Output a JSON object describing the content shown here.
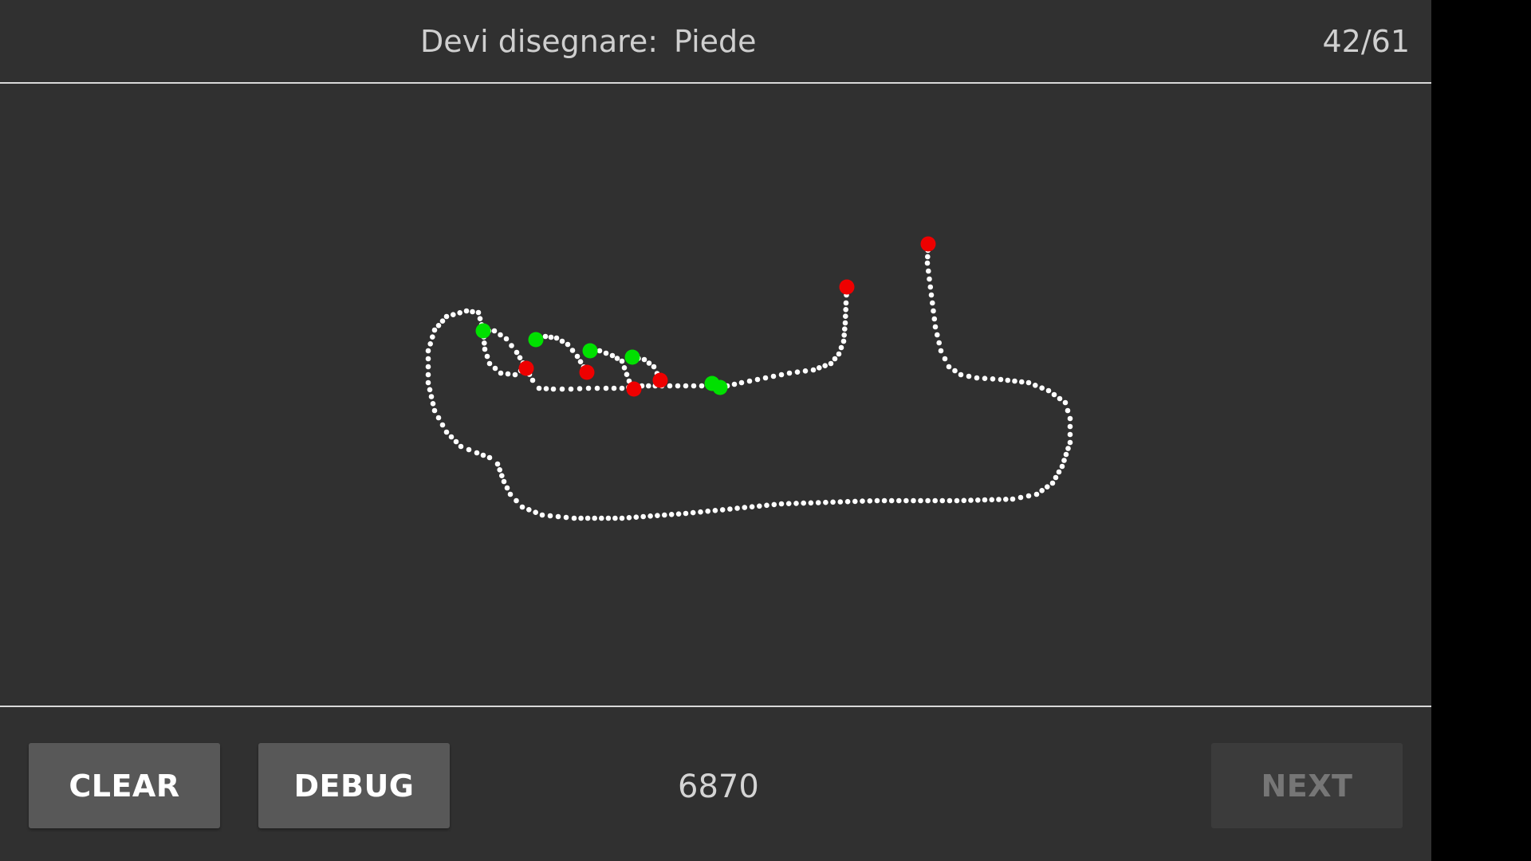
{
  "header": {
    "prompt_label": "Devi disegnare:",
    "prompt_word": "Piede",
    "progress": "42/61"
  },
  "canvas": {
    "background_color": "#303030",
    "stroke_color": "#ffffff",
    "start_marker_color": "#00e000",
    "end_marker_color": "#ee0000"
  },
  "footer": {
    "clear_label": "CLEAR",
    "debug_label": "DEBUG",
    "score": "6870",
    "next_label": "NEXT"
  }
}
